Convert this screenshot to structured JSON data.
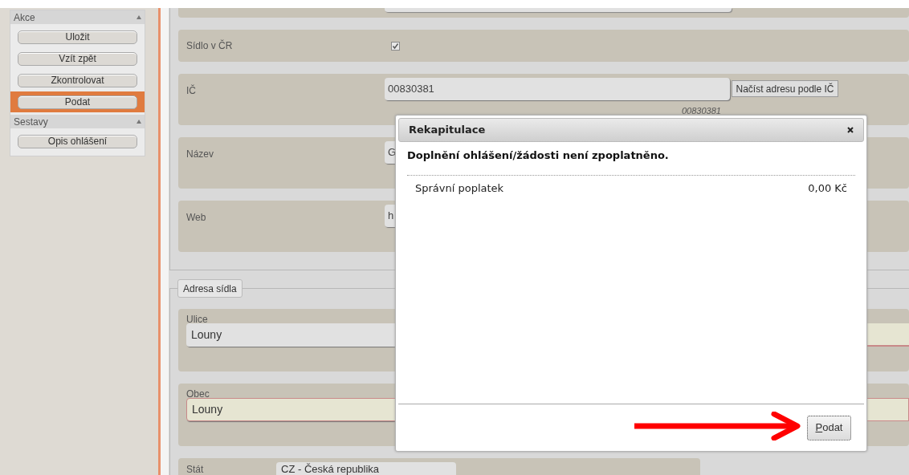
{
  "sidebar": {
    "sections": [
      {
        "title": "Akce",
        "items": [
          {
            "label": "Uložit",
            "selected": false
          },
          {
            "label": "Vzít zpět",
            "selected": false
          },
          {
            "label": "Zkontrolovat",
            "selected": false
          },
          {
            "label": "Podat",
            "selected": true
          }
        ]
      },
      {
        "title": "Sestavy",
        "items": [
          {
            "label": "Opis ohlášení",
            "selected": false
          }
        ]
      }
    ]
  },
  "company": {
    "rows": [
      {
        "kind": "checkbox",
        "label": "Sídlo v ČR",
        "checked": true
      },
      {
        "kind": "lookup",
        "label": "IČ",
        "value": "00830381",
        "button": "Načíst adresu podle IČ",
        "hint": "00830381"
      },
      {
        "kind": "input",
        "label": "Název",
        "value": "G"
      },
      {
        "kind": "input",
        "label": "Web",
        "value": "h"
      }
    ]
  },
  "address": {
    "legend": "Adresa sídla",
    "rows": [
      {
        "kind": "stacked",
        "label": "Ulice",
        "value": "Louny",
        "required": false,
        "side_field_required": true
      },
      {
        "kind": "stacked",
        "label": "Obec",
        "value": "Louny",
        "required": true,
        "side_field_required": false
      },
      {
        "kind": "select",
        "label": "Stát",
        "value": "CZ - Česká republika"
      }
    ]
  },
  "dialog": {
    "title": "Rekapitulace",
    "message": "Doplnění ohlášení/žádosti není zpoplatněno.",
    "items": [
      {
        "label": "Správní poplatek",
        "amount": "0,00 Kč"
      }
    ],
    "button": "Podat"
  }
}
